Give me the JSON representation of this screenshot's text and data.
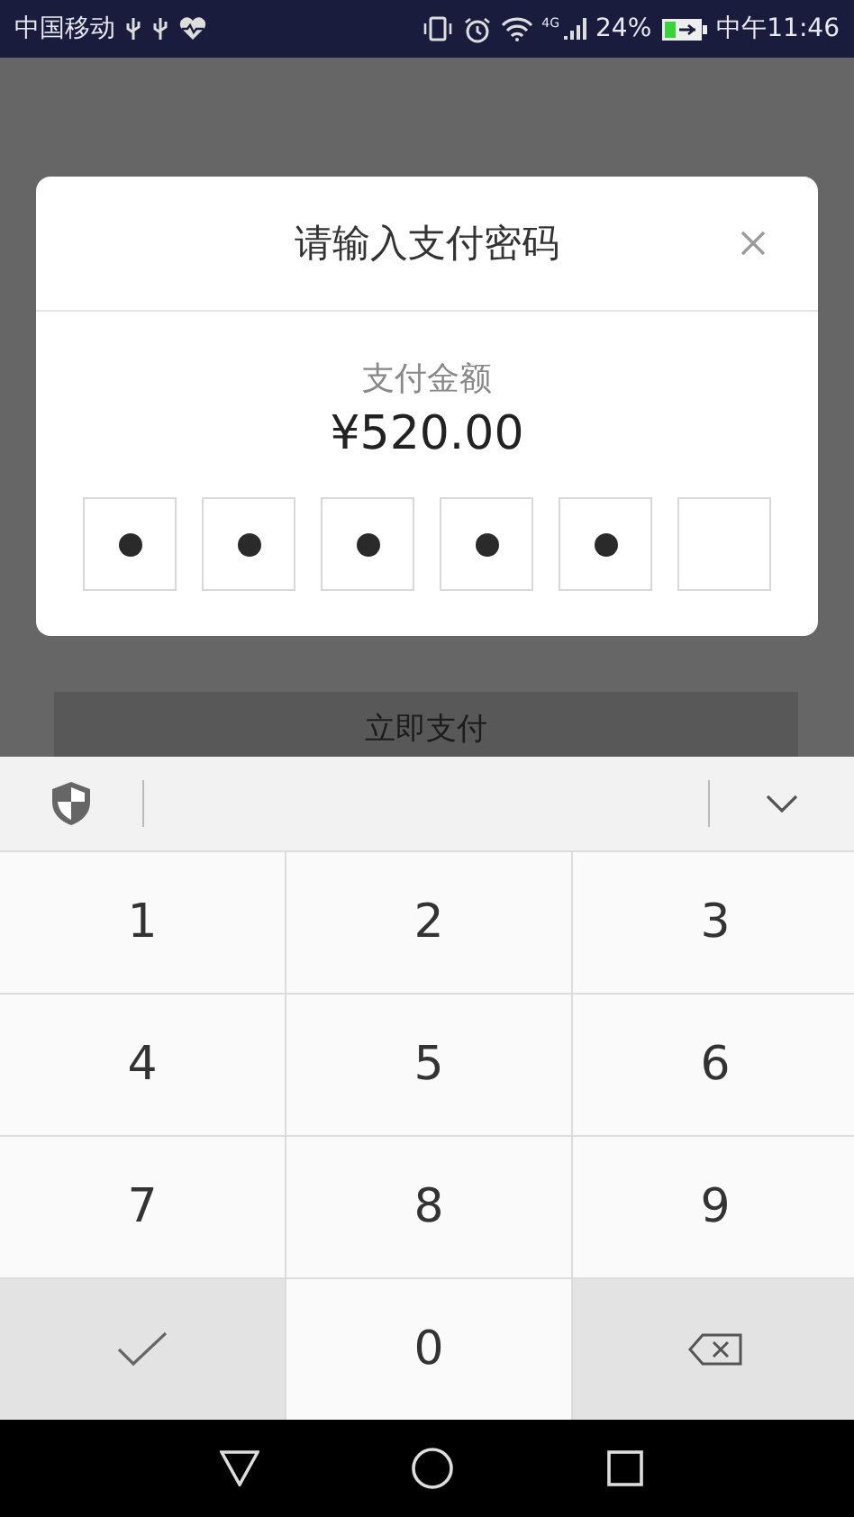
{
  "status_bar": {
    "carrier": "中国移动",
    "network": "4G",
    "battery": "24%",
    "time": "中午11:46"
  },
  "pay_button": {
    "label": "立即支付"
  },
  "dialog": {
    "title": "请输入支付密码",
    "amount_label": "支付金额",
    "amount": "¥520.00",
    "pin_boxes": [
      {
        "filled": true
      },
      {
        "filled": true
      },
      {
        "filled": true
      },
      {
        "filled": true
      },
      {
        "filled": true
      },
      {
        "filled": false
      }
    ]
  },
  "keypad": {
    "keys": [
      {
        "kind": "digit",
        "label": "1"
      },
      {
        "kind": "digit",
        "label": "2"
      },
      {
        "kind": "digit",
        "label": "3"
      },
      {
        "kind": "digit",
        "label": "4"
      },
      {
        "kind": "digit",
        "label": "5"
      },
      {
        "kind": "digit",
        "label": "6"
      },
      {
        "kind": "digit",
        "label": "7"
      },
      {
        "kind": "digit",
        "label": "8"
      },
      {
        "kind": "digit",
        "label": "9"
      },
      {
        "kind": "confirm"
      },
      {
        "kind": "digit",
        "label": "0"
      },
      {
        "kind": "delete"
      }
    ]
  }
}
